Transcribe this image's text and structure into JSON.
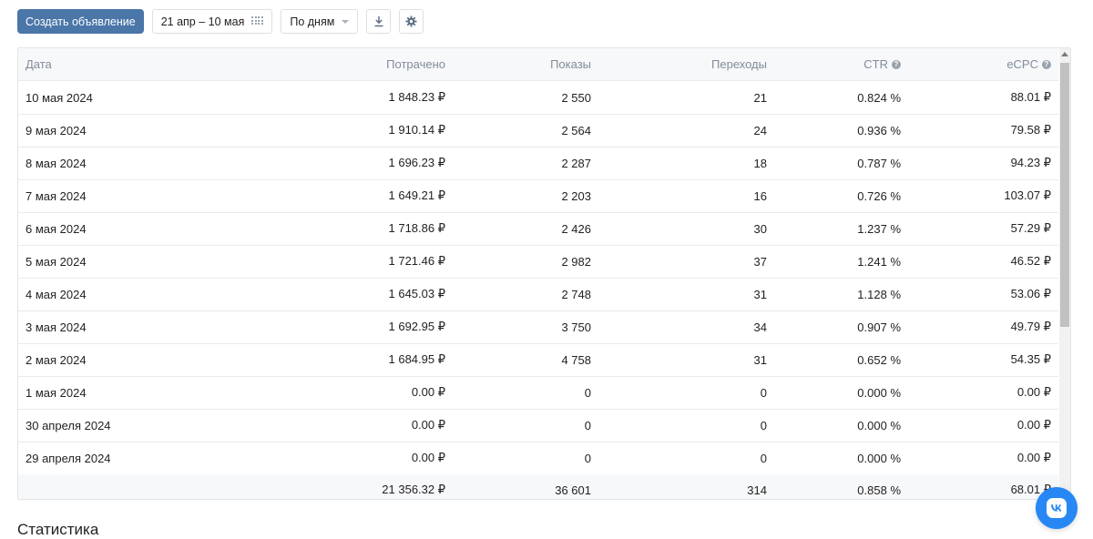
{
  "toolbar": {
    "create_label": "Создать объявление",
    "date_range": "21 апр – 10 мая",
    "grouping": "По дням"
  },
  "table": {
    "headers": {
      "date": "Дата",
      "spent": "Потрачено",
      "views": "Показы",
      "clicks": "Переходы",
      "ctr": "CTR",
      "ecpc": "eCPC"
    },
    "rows": [
      {
        "date": "10 мая 2024",
        "spent": "1 848.23 ₽",
        "views": "2 550",
        "clicks": "21",
        "ctr": "0.824 %",
        "ecpc": "88.01 ₽"
      },
      {
        "date": "9 мая 2024",
        "spent": "1 910.14 ₽",
        "views": "2 564",
        "clicks": "24",
        "ctr": "0.936 %",
        "ecpc": "79.58 ₽"
      },
      {
        "date": "8 мая 2024",
        "spent": "1 696.23 ₽",
        "views": "2 287",
        "clicks": "18",
        "ctr": "0.787 %",
        "ecpc": "94.23 ₽"
      },
      {
        "date": "7 мая 2024",
        "spent": "1 649.21 ₽",
        "views": "2 203",
        "clicks": "16",
        "ctr": "0.726 %",
        "ecpc": "103.07 ₽"
      },
      {
        "date": "6 мая 2024",
        "spent": "1 718.86 ₽",
        "views": "2 426",
        "clicks": "30",
        "ctr": "1.237 %",
        "ecpc": "57.29 ₽"
      },
      {
        "date": "5 мая 2024",
        "spent": "1 721.46 ₽",
        "views": "2 982",
        "clicks": "37",
        "ctr": "1.241 %",
        "ecpc": "46.52 ₽"
      },
      {
        "date": "4 мая 2024",
        "spent": "1 645.03 ₽",
        "views": "2 748",
        "clicks": "31",
        "ctr": "1.128 %",
        "ecpc": "53.06 ₽"
      },
      {
        "date": "3 мая 2024",
        "spent": "1 692.95 ₽",
        "views": "3 750",
        "clicks": "34",
        "ctr": "0.907 %",
        "ecpc": "49.79 ₽"
      },
      {
        "date": "2 мая 2024",
        "spent": "1 684.95 ₽",
        "views": "4 758",
        "clicks": "31",
        "ctr": "0.652 %",
        "ecpc": "54.35 ₽"
      },
      {
        "date": "1 мая 2024",
        "spent": "0.00 ₽",
        "views": "0",
        "clicks": "0",
        "ctr": "0.000 %",
        "ecpc": "0.00 ₽"
      },
      {
        "date": "30 апреля 2024",
        "spent": "0.00 ₽",
        "views": "0",
        "clicks": "0",
        "ctr": "0.000 %",
        "ecpc": "0.00 ₽"
      },
      {
        "date": "29 апреля 2024",
        "spent": "0.00 ₽",
        "views": "0",
        "clicks": "0",
        "ctr": "0.000 %",
        "ecpc": "0.00 ₽"
      }
    ],
    "totals": {
      "spent": "21 356.32 ₽",
      "views": "36 601",
      "clicks": "314",
      "ctr": "0.858 %",
      "ecpc": "68.01 ₽"
    }
  },
  "below": {
    "title": "Статистика"
  },
  "icons": {
    "calendar": "calendar-icon",
    "caret": "chevron-down-icon",
    "download": "download-icon",
    "settings": "gear-icon",
    "help": "help-icon",
    "vk": "vk-logo-icon"
  },
  "colors": {
    "primary": "#4a76a8",
    "vk_blue": "#2787f5",
    "header_bg": "#f7f8fa"
  }
}
